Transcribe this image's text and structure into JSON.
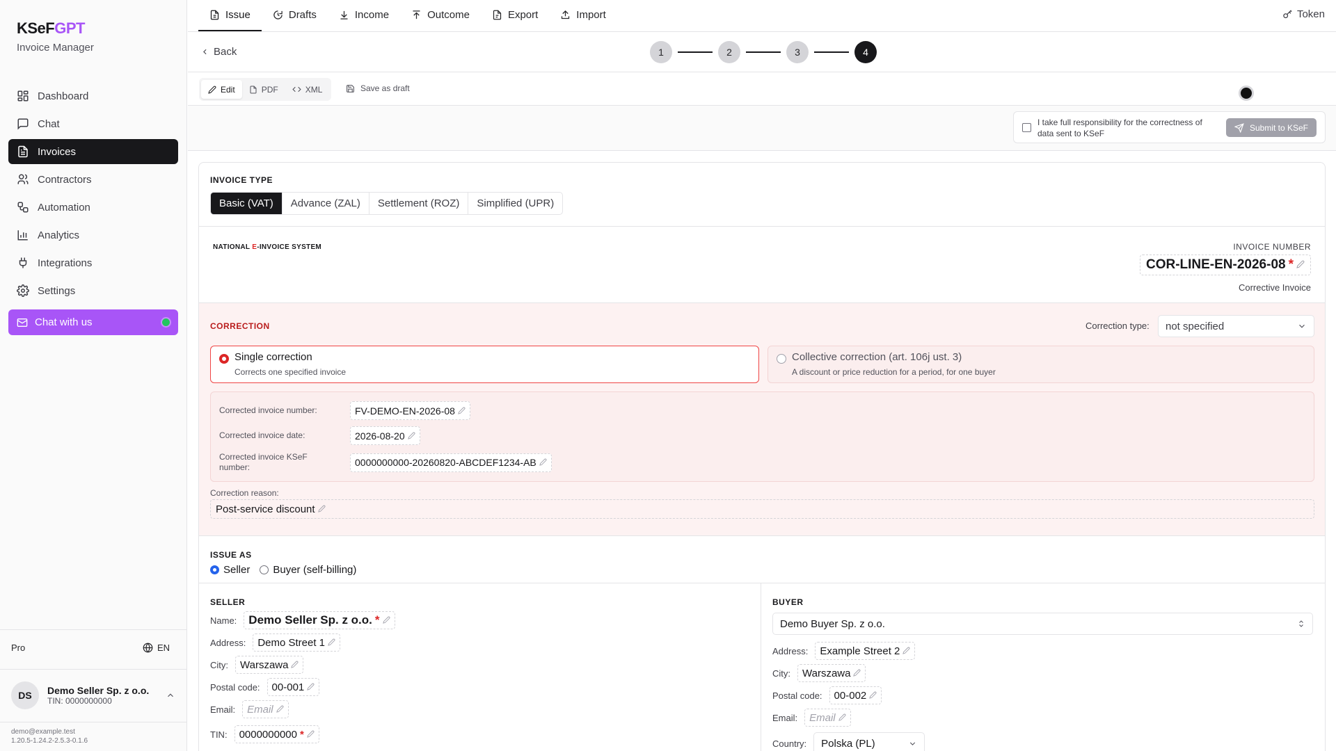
{
  "brand": {
    "name_main": "KSeF",
    "name_accent": "GPT",
    "subtitle": "Invoice Manager",
    "accent_color": "#a855f7"
  },
  "sidebar": {
    "items": [
      {
        "label": "Dashboard",
        "icon": "dashboard-icon"
      },
      {
        "label": "Chat",
        "icon": "chat-icon"
      },
      {
        "label": "Invoices",
        "icon": "invoice-icon",
        "active": true
      },
      {
        "label": "Contractors",
        "icon": "users-icon"
      },
      {
        "label": "Automation",
        "icon": "workflow-icon"
      },
      {
        "label": "Analytics",
        "icon": "bar-chart-icon"
      },
      {
        "label": "Integrations",
        "icon": "plug-icon"
      },
      {
        "label": "Settings",
        "icon": "gear-icon"
      }
    ],
    "chat_with_us": "Chat with us",
    "plan": "Pro",
    "language": "EN",
    "user": {
      "initials": "DS",
      "name": "Demo Seller Sp. z o.o.",
      "tin": "TIN: 0000000000"
    },
    "email": "demo@example.test",
    "version": "1.20.5-1.24.2-2.5.3-0.1.6"
  },
  "topnav": {
    "tabs": [
      {
        "label": "Issue",
        "icon": "file-icon",
        "active": true
      },
      {
        "label": "Drafts",
        "icon": "draft-icon"
      },
      {
        "label": "Income",
        "icon": "download-icon"
      },
      {
        "label": "Outcome",
        "icon": "upload-icon"
      },
      {
        "label": "Export",
        "icon": "file-export-icon"
      },
      {
        "label": "Import",
        "icon": "import-icon"
      }
    ],
    "token": "Token"
  },
  "subheader": {
    "back": "Back",
    "steps": [
      "1",
      "2",
      "3",
      "4"
    ],
    "active_step": 4
  },
  "toolbar": {
    "edit": "Edit",
    "pdf": "PDF",
    "xml": "XML",
    "save_draft": "Save as draft"
  },
  "submit": {
    "responsibility": "I take full responsibility for the correctness of data sent to KSeF",
    "button": "Submit to KSeF"
  },
  "invoice_type": {
    "title": "INVOICE TYPE",
    "tabs": [
      "Basic (VAT)",
      "Advance (ZAL)",
      "Settlement (ROZ)",
      "Simplified (UPR)"
    ],
    "active": 0
  },
  "header": {
    "system_prefix": "NATIONAL ",
    "system_e": "E",
    "system_suffix": "-INVOICE SYSTEM",
    "number_label": "INVOICE NUMBER",
    "number": "COR-LINE-EN-2026-08",
    "kind": "Corrective Invoice"
  },
  "correction": {
    "title": "CORRECTION",
    "type_label": "Correction type:",
    "type_value": "not specified",
    "single": {
      "label": "Single correction",
      "desc": "Corrects one specified invoice"
    },
    "collective": {
      "label": "Collective correction (art. 106j ust. 3)",
      "desc": "A discount or price reduction for a period, for one buyer"
    },
    "fields": {
      "number_label": "Corrected invoice number:",
      "number": "FV-DEMO-EN-2026-08",
      "date_label": "Corrected invoice date:",
      "date": "2026-08-20",
      "ksef_label": "Corrected invoice KSeF number:",
      "ksef": "0000000000-20260820-ABCDEF1234-AB"
    },
    "reason_label": "Correction reason:",
    "reason": "Post-service discount"
  },
  "issue_as": {
    "title": "ISSUE AS",
    "seller": "Seller",
    "buyer": "Buyer (self-billing)"
  },
  "seller": {
    "title": "SELLER",
    "name_label": "Name:",
    "name": "Demo Seller Sp. z o.o.",
    "address_label": "Address:",
    "address": "Demo Street 1",
    "city_label": "City:",
    "city": "Warszawa",
    "postal_label": "Postal code:",
    "postal": "00-001",
    "email_label": "Email:",
    "email_placeholder": "Email",
    "tin_label": "TIN:",
    "tin": "0000000000"
  },
  "buyer": {
    "title": "BUYER",
    "select": "Demo Buyer Sp. z o.o.",
    "address_label": "Address:",
    "address": "Example Street 2",
    "city_label": "City:",
    "city": "Warszawa",
    "postal_label": "Postal code:",
    "postal": "00-002",
    "email_label": "Email:",
    "email_placeholder": "Email",
    "country_label": "Country:",
    "country": "Polska (PL)"
  }
}
